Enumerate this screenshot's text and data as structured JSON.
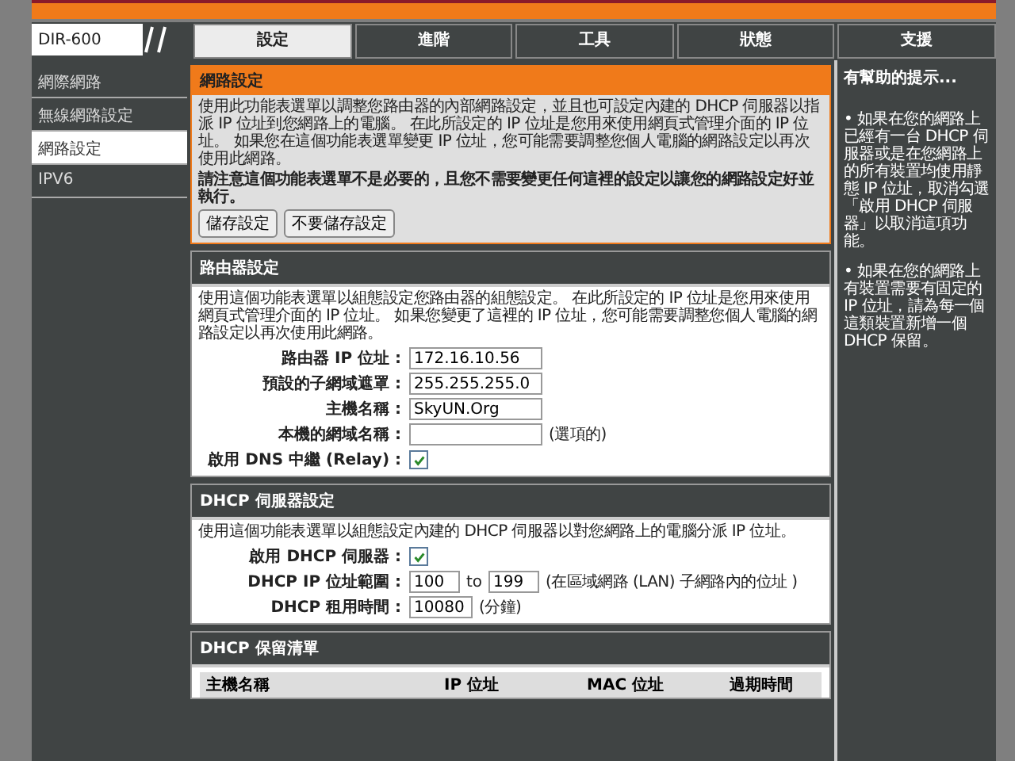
{
  "header": {
    "logo": "DIR-600"
  },
  "tabs": [
    {
      "label": "設定",
      "selected": true
    },
    {
      "label": "進階",
      "selected": false
    },
    {
      "label": "工具",
      "selected": false
    },
    {
      "label": "狀態",
      "selected": false
    },
    {
      "label": "支援",
      "selected": false
    }
  ],
  "sidebar": {
    "items": [
      {
        "label": "網際網路",
        "selected": false
      },
      {
        "label": "無線網路設定",
        "selected": false
      },
      {
        "label": "網路設定",
        "selected": true
      },
      {
        "label": "IPV6",
        "selected": false
      }
    ]
  },
  "intro": {
    "title": "網路設定",
    "text": "使用此功能表選單以調整您路由器的內部網路設定，並且也可設定內建的 DHCP 伺服器以指派 IP 位址到您網路上的電腦。 在此所設定的 IP 位址是您用來使用網頁式管理介面的 IP 位址。 如果您在這個功能表選單變更 IP 位址，您可能需要調整您個人電腦的網路設定以再次使用此網路。",
    "note": "請注意這個功能表選單不是必要的，且您不需要變更任何這裡的設定以讓您的網路設定好並執行。",
    "buttons": [
      "儲存設定",
      "不要儲存設定"
    ]
  },
  "router_settings": {
    "title": "路由器設定",
    "text": "使用這個功能表選單以組態設定您路由器的組態設定。 在此所設定的 IP 位址是您用來使用網頁式管理介面的 IP 位址。 如果您變更了這裡的 IP 位址，您可能需要調整您個人電腦的網路設定以再次使用此網路。",
    "fields": [
      {
        "kind": "text",
        "label": "路由器 IP 位址 :",
        "value": "172.16.10.56"
      },
      {
        "kind": "text",
        "label": "預設的子網域遮罩 :",
        "value": "255.255.255.0"
      },
      {
        "kind": "text",
        "label": "主機名稱 :",
        "value": "SkyUN.Org"
      },
      {
        "kind": "text",
        "label": "本機的網域名稱 :",
        "suffix": "(選項的)"
      },
      {
        "kind": "checkbox",
        "label": "啟用 DNS 中繼 (Relay) :",
        "checked": true
      }
    ]
  },
  "dhcp_settings": {
    "title": "DHCP 伺服器設定",
    "text": "使用這個功能表選單以組態設定內建的 DHCP 伺服器以對您網路上的電腦分派 IP 位址。",
    "fields": [
      {
        "kind": "checkbox",
        "label": "啟用 DHCP 伺服器 :",
        "checked": true
      },
      {
        "kind": "range",
        "label": "DHCP IP 位址範圍 :",
        "from": "100",
        "separator": "to",
        "to": "199",
        "suffix": "(在區域網路 (LAN) 子網路內的位址 )"
      },
      {
        "kind": "text",
        "label": "DHCP 租用時間 :",
        "value": "10080",
        "suffix": "(分鐘)"
      }
    ]
  },
  "reservations": {
    "title": "DHCP 保留清單",
    "columns": [
      "主機名稱",
      "IP 位址",
      "MAC 位址",
      "過期時間"
    ]
  },
  "help": {
    "title": "有幫助的提示...",
    "tips": [
      "• 如果在您的網路上已經有一台 DHCP 伺服器或是在您網路上的所有裝置均使用靜態 IP 位址，取消勾選「啟用 DHCP 伺服器」以取消這項功能。",
      "• 如果在您的網路上有裝置需要有固定的 IP 位址，請為每一個這類裝置新增一個DHCP 保留。"
    ]
  }
}
